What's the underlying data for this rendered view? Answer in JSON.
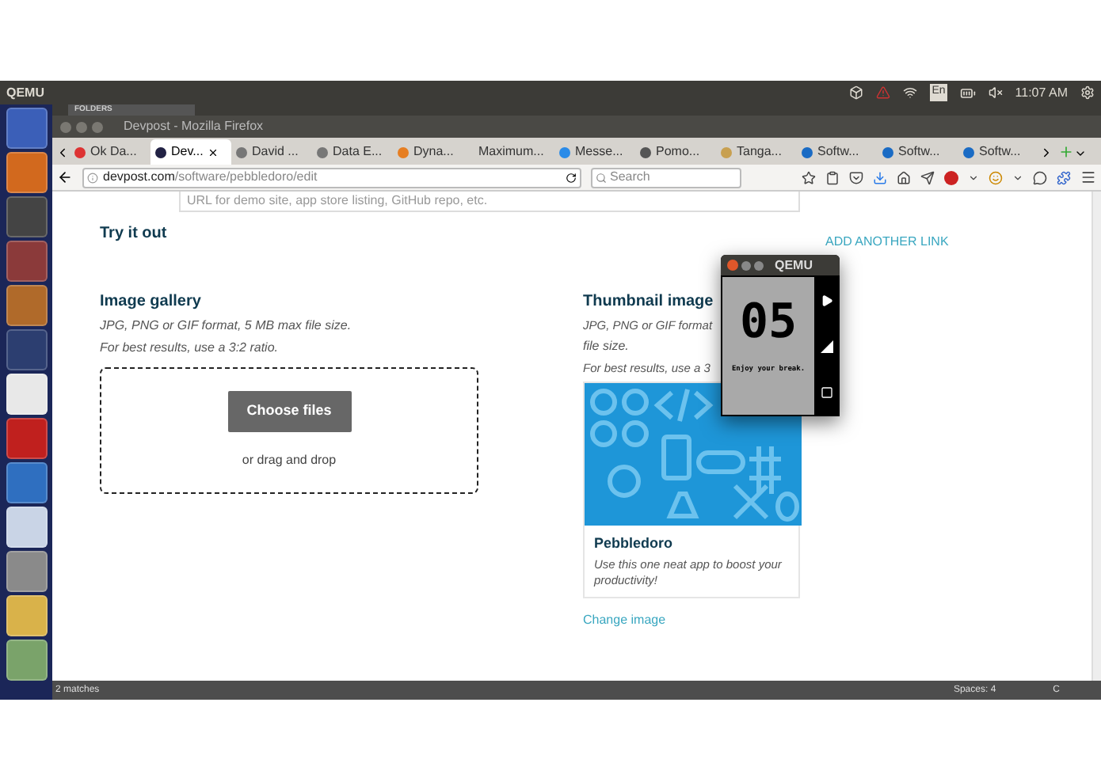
{
  "top_panel": {
    "title": "QEMU",
    "keyboard": "En",
    "clock": "11:07 AM"
  },
  "background_window": {
    "sidebar_label": "FOLDERS"
  },
  "window": {
    "title": "Devpost - Mozilla Firefox"
  },
  "tabs": [
    {
      "label": "Ok Da...",
      "selected": false
    },
    {
      "label": "Dev...",
      "selected": true
    },
    {
      "label": "David ...",
      "selected": false
    },
    {
      "label": "Data E...",
      "selected": false
    },
    {
      "label": "Dyna...",
      "selected": false
    },
    {
      "label": "Maximum...",
      "selected": false
    },
    {
      "label": "Messe...",
      "selected": false
    },
    {
      "label": "Pomo...",
      "selected": false
    },
    {
      "label": "Tanga...",
      "selected": false
    },
    {
      "label": "Softw...",
      "selected": false
    },
    {
      "label": "Softw...",
      "selected": false
    },
    {
      "label": "Softw...",
      "selected": false
    }
  ],
  "address_bar": {
    "host": "devpost.com",
    "path": "/software/pebbledoro/edit"
  },
  "search": {
    "placeholder": "Search"
  },
  "page": {
    "link_field": {
      "placeholder": "URL for demo site, app store listing, GitHub repo, etc."
    },
    "try_it_out": "Try it out",
    "add_link": "ADD ANOTHER LINK",
    "gallery": {
      "heading": "Image gallery",
      "hint_1": "JPG, PNG or GIF format, 5 MB max file size.",
      "hint_2": "For best results, use a 3:2 ratio.",
      "button": "Choose files",
      "drop": "or drag and drop"
    },
    "thumbnail": {
      "heading": "Thumbnail image",
      "hint_1": "JPG, PNG or GIF format",
      "hint_2": "file size.",
      "hint_3": "For best results, use a 3",
      "card_title": "Pebbledoro",
      "card_text": "Use this one neat app to boost your productivity!",
      "change": "Change image"
    }
  },
  "popup": {
    "title": "QEMU",
    "count": "05",
    "message": "Enjoy your break."
  },
  "status_bar": {
    "matches": "2 matches",
    "spaces": "Spaces: 4",
    "column_3": "C"
  }
}
